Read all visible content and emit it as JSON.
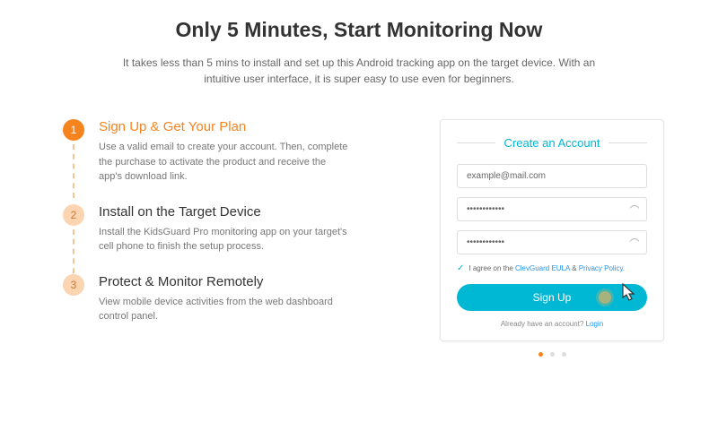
{
  "header": {
    "title": "Only 5 Minutes, Start Monitoring Now",
    "subtitle": "It takes less than 5 mins to install and set up this Android tracking app on the target device. With an intuitive user interface, it is super easy to use even for beginners."
  },
  "steps": [
    {
      "num": "1",
      "title": "Sign Up & Get Your Plan",
      "desc": "Use a valid email to create your account. Then, complete the purchase to activate the product and receive the app's download link."
    },
    {
      "num": "2",
      "title": "Install on the Target Device",
      "desc": "Install the KidsGuard Pro monitoring app on your target's cell phone to finish the setup process."
    },
    {
      "num": "3",
      "title": "Protect & Monitor Remotely",
      "desc": "View mobile device activities from the web dashboard control panel."
    }
  ],
  "form": {
    "heading": "Create an Account",
    "email_value": "example@mail.com",
    "password_value": "••••••••••••",
    "confirm_value": "••••••••••••",
    "agree_prefix": "I agree on the ",
    "agree_link1": "ClevGuard EULA",
    "agree_amp": " & ",
    "agree_link2": "Privacy Policy",
    "agree_suffix": ".",
    "signup_label": "Sign Up",
    "already_prefix": "Already have an account? ",
    "already_link": "Login"
  }
}
